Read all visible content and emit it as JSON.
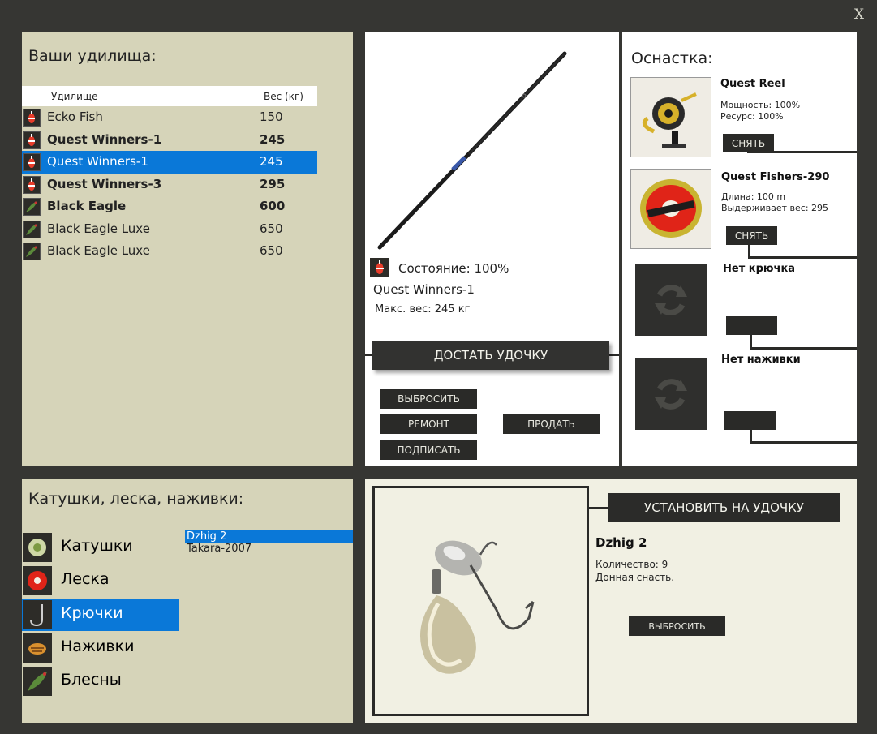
{
  "window": {
    "close_label": "X"
  },
  "rods_panel": {
    "title": "Ваши удилища:",
    "col_name": "Удилище",
    "col_weight": "Вес (кг)",
    "rows": [
      {
        "name": "Ecko Fish",
        "weight": "150"
      },
      {
        "name": "Quest Winners-1",
        "weight": "245"
      },
      {
        "name": "Quest Winners-1",
        "weight": "245"
      },
      {
        "name": "Quest Winners-3",
        "weight": "295"
      },
      {
        "name": "Black Eagle",
        "weight": "600"
      },
      {
        "name": "Black Eagle Luxe",
        "weight": "650"
      },
      {
        "name": "Black Eagle Luxe",
        "weight": "650"
      }
    ]
  },
  "rod_detail": {
    "condition": "Состояние: 100%",
    "name": "Quest Winners-1",
    "max_weight": "Макс. вес: 245 кг",
    "take_button": "ДОСТАТЬ УДОЧКУ",
    "throw_button": "ВЫБРОСИТЬ",
    "repair_button": "РЕМОНТ",
    "sell_button": "ПРОДАТЬ",
    "sign_button": "ПОДПИСАТЬ"
  },
  "tackle": {
    "title": "Оснастка:",
    "reel": {
      "name": "Quest Reel",
      "line1": "Мощность: 100%",
      "line2": "Ресурс: 100%",
      "button": "СНЯТЬ"
    },
    "fishing_line": {
      "name": "Quest Fishers-290",
      "line1": "Длина: 100 m",
      "line2": "Выдерживает вес: 295",
      "button": "СНЯТЬ"
    },
    "hook": {
      "name": "Нет крючка"
    },
    "bait": {
      "name": "Нет наживки"
    }
  },
  "categories_panel": {
    "title": "Катушки, леска, наживки:",
    "items": [
      {
        "label": "Катушки"
      },
      {
        "label": "Леска"
      },
      {
        "label": "Крючки"
      },
      {
        "label": "Наживки"
      },
      {
        "label": "Блесны"
      }
    ],
    "sub_items": [
      "Dzhig 2",
      "Takara-2007"
    ]
  },
  "item_detail": {
    "install_button": "УСТАНОВИТЬ НА УДОЧКУ",
    "name": "Dzhig 2",
    "quantity": "Количество: 9",
    "description": "Донная снасть.",
    "throw_button": "ВЫБРОСИТЬ"
  },
  "colors": {
    "selection": "#0a78d8",
    "panel_tan": "#d6d4b9",
    "frame": "#363633",
    "button_dark": "#2a2a28"
  }
}
